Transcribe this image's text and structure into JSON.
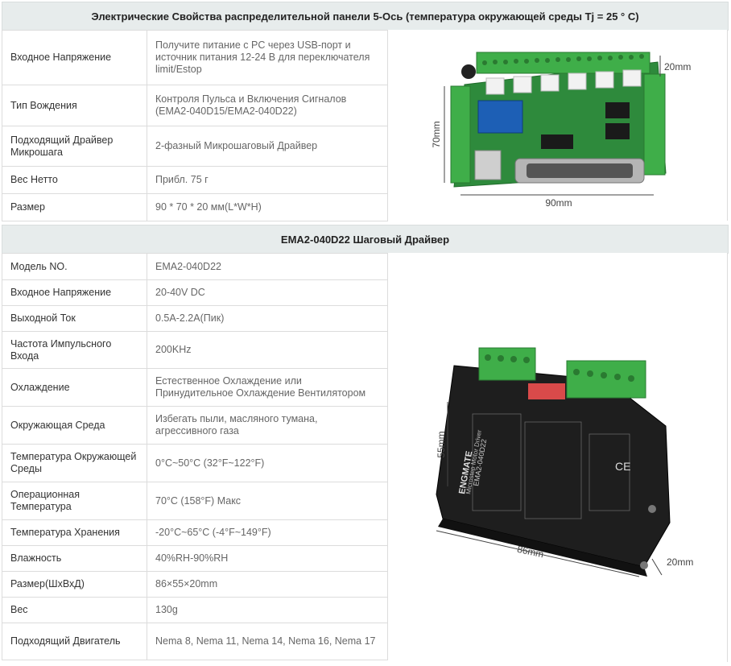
{
  "section1": {
    "title": "Электрические Свойства распределительной панели 5-Ось (температура окружающей среды Tj = 25 ° C)",
    "rows": [
      {
        "label": "Входное Напряжение",
        "value": "Получите питание с PC через USB-порт и источник питания 12-24 В для переключателя limit/Estop"
      },
      {
        "label": "Тип Вождения",
        "value": "Контроля Пульса и Включения Сигналов (EMA2-040D15/EMA2-040D22)"
      },
      {
        "label": "Подходящий Драйвер Микрошага",
        "value": "2-фазный Микрошаговый Драйвер"
      },
      {
        "label": "Вес Нетто",
        "value": "Прибл. 75 г"
      },
      {
        "label": "Размер",
        "value": "90 * 70 * 20 мм(L*W*H)"
      }
    ],
    "image": {
      "dim_height": "70mm",
      "dim_width": "90mm",
      "dim_depth": "20mm"
    }
  },
  "section2": {
    "title": "EMA2-040D22 Шаговый Драйвер",
    "rows": [
      {
        "label": "Модель NO.",
        "value": "EMA2-040D22"
      },
      {
        "label": "Входное Напряжение",
        "value": "20-40V DC"
      },
      {
        "label": "Выходной Ток",
        "value": "0.5A-2.2A(Пик)"
      },
      {
        "label": "Частота Импульсного Входа",
        "value": "200KHz"
      },
      {
        "label": "Охлаждение",
        "value": "Естественное Охлаждение или Принудительное Охлаждение Вентилятором"
      },
      {
        "label": "Окружающая Среда",
        "value": "Избегать пыли, масляного тумана, агрессивного газа"
      },
      {
        "label": "Температура Окружающей Среды",
        "value": "0°C~50°C (32°F~122°F)"
      },
      {
        "label": "Операционная Температура",
        "value": "70°C (158°F) Макс"
      },
      {
        "label": "Температура Хранения",
        "value": "-20°C~65°C (-4°F~149°F)"
      },
      {
        "label": "Влажность",
        "value": "40%RH-90%RH"
      },
      {
        "label": "Размер(ШхВхД)",
        "value": "86×55×20mm"
      },
      {
        "label": "Вес",
        "value": "130g"
      },
      {
        "label": "Подходящий Двигатель",
        "value": "Nema 8, Nema 11, Nema 14, Nema 16, Nema 17"
      }
    ],
    "image": {
      "dim_height": "55mm",
      "dim_width": "86mm",
      "dim_depth": "20mm",
      "brand": "ENGMATE",
      "model": "EMA2-040D22",
      "subtitle": "Microstep Motor Driver"
    }
  },
  "colors": {
    "header_bg": "#e7ecec",
    "border": "#dcdcdc",
    "pcb_green": "#2f8f3f",
    "terminal_green": "#3fae49",
    "driver_black": "#1e1e1e"
  }
}
